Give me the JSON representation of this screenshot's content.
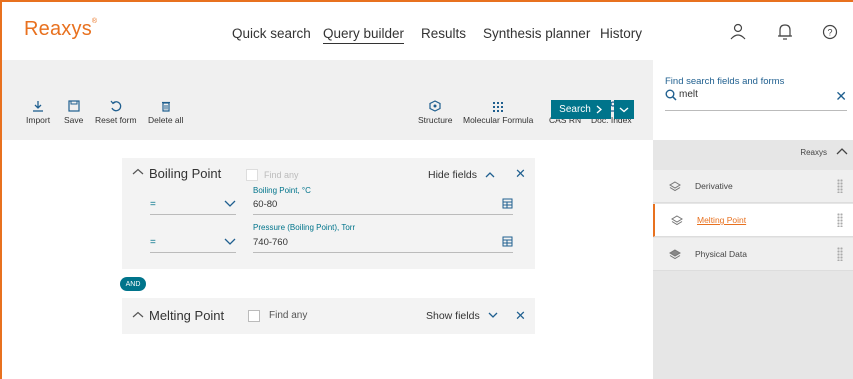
{
  "app": {
    "logo": "Reaxys",
    "logo_mark": "®"
  },
  "nav": [
    "Quick search",
    "Query builder",
    "Results",
    "Synthesis planner",
    "History"
  ],
  "toolbar": {
    "left": [
      "Import",
      "Save",
      "Reset form",
      "Delete all"
    ],
    "right": [
      "Structure",
      "Molecular Formula",
      "CAS RN",
      "Doc. Index"
    ],
    "search_label": "Search"
  },
  "query": {
    "boiling": {
      "title": "Boiling Point",
      "find_any": "Find any",
      "toggle": "Hide fields",
      "fields": [
        {
          "label": "Boiling Point, °C",
          "operator": "=",
          "value": "60-80"
        },
        {
          "label": "Pressure (Boiling Point), Torr",
          "operator": "=",
          "value": "740-760"
        }
      ]
    },
    "connector": "AND",
    "melting": {
      "title": "Melting Point",
      "find_any": "Find any",
      "toggle": "Show fields"
    }
  },
  "panel": {
    "heading": "Find search fields and forms",
    "search_value": "melt",
    "source": "Reaxys",
    "items": [
      "Derivative",
      "Melting Point",
      "Physical Data"
    ],
    "selected": "Melting Point"
  },
  "colors": {
    "accent": "#e8711f",
    "primary": "#00748b",
    "link": "#1f5f8f"
  }
}
